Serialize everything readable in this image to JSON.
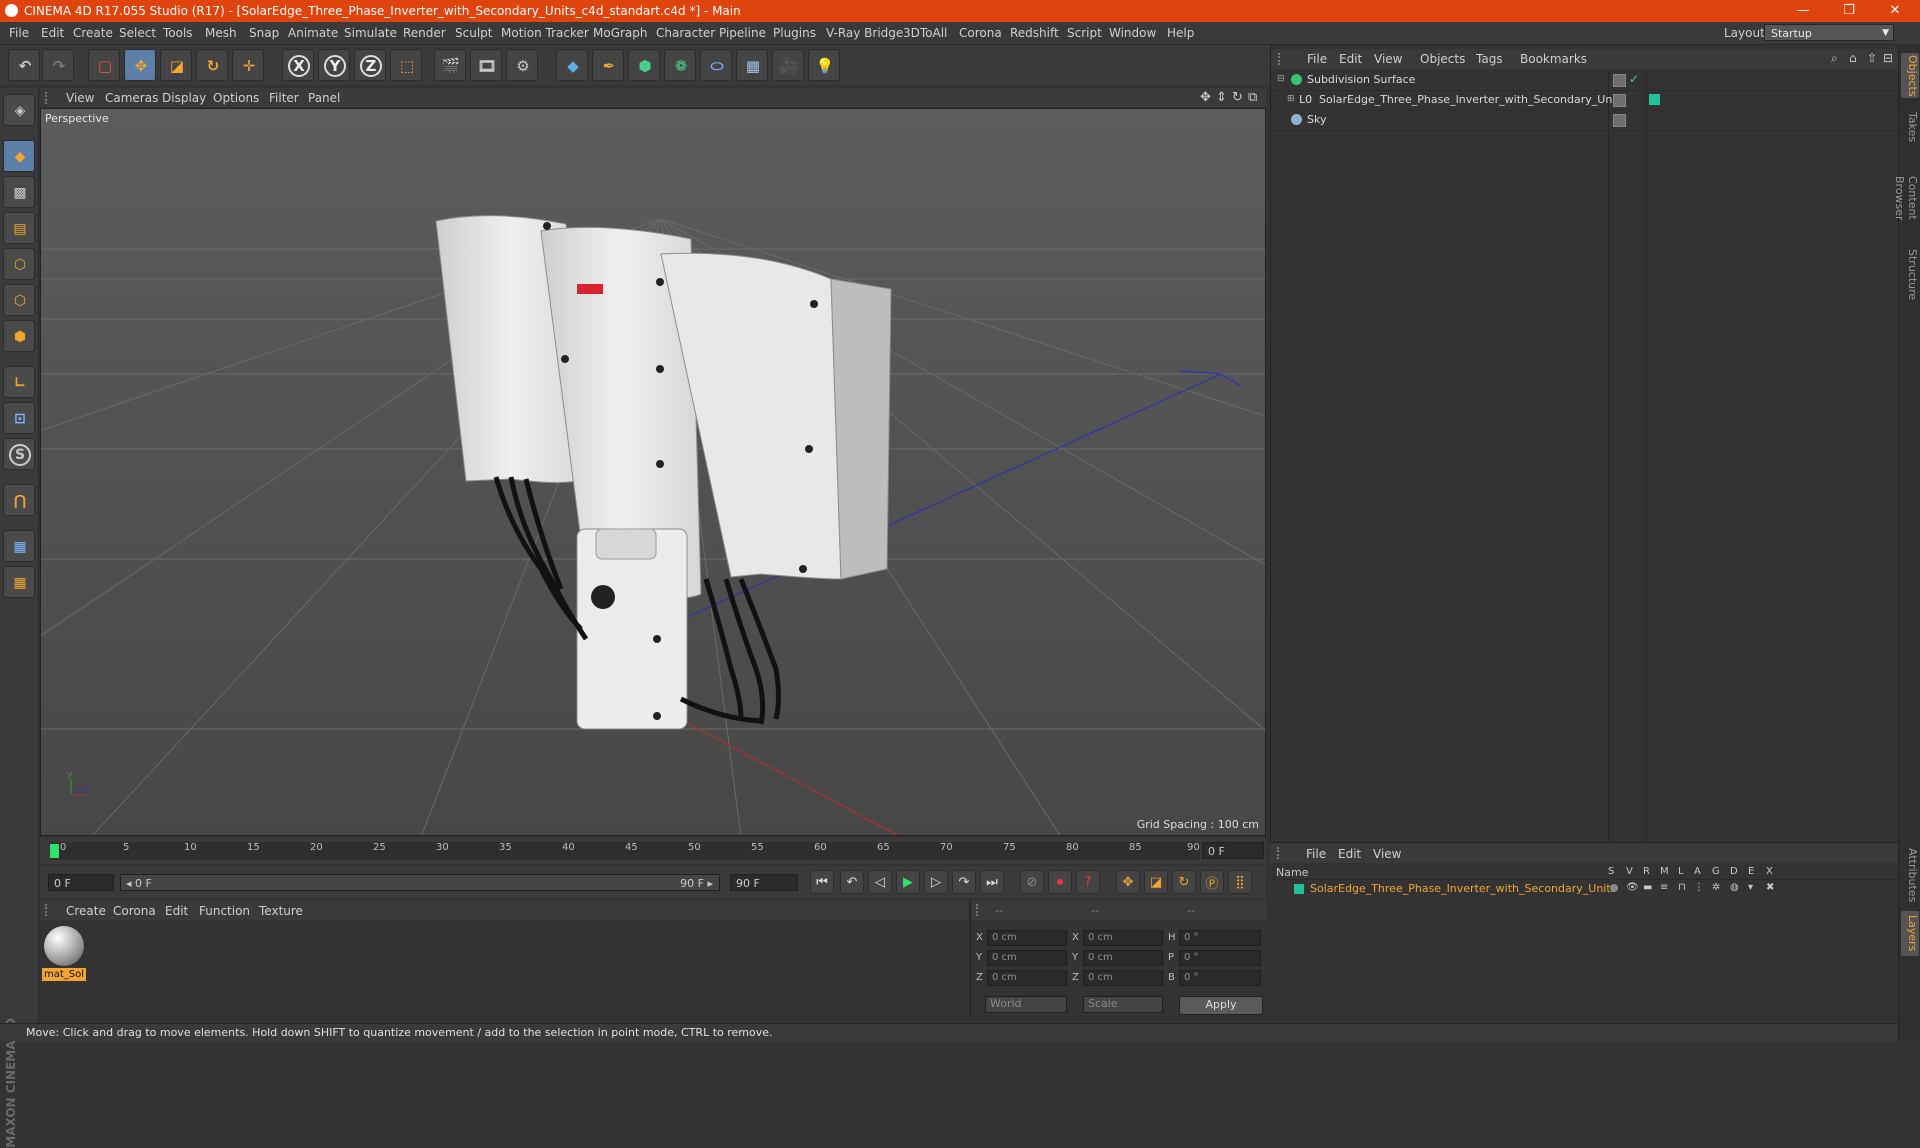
{
  "window": {
    "title": "CINEMA 4D R17.055 Studio (R17) - [SolarEdge_Three_Phase_Inverter_with_Secondary_Units_c4d_standart.c4d *] - Main",
    "minimize": "—",
    "restore": "❐",
    "close": "✕"
  },
  "menu": [
    "File",
    "Edit",
    "Create",
    "Select",
    "Tools",
    "Mesh",
    "Snap",
    "Animate",
    "Simulate",
    "Render",
    "Sculpt",
    "Motion Tracker",
    "MoGraph",
    "Character",
    "Pipeline",
    "Plugins",
    "V-Ray Bridge",
    "3DToAll",
    "Corona",
    "Redshift",
    "Script",
    "Window",
    "Help"
  ],
  "layout": {
    "label": "Layout:",
    "value": "Startup"
  },
  "toolbar": {
    "axis_x": "X",
    "axis_y": "Y",
    "axis_z": "Z"
  },
  "viewport": {
    "menu": [
      "View",
      "Cameras",
      "Display",
      "Options",
      "Filter",
      "Panel"
    ],
    "label": "Perspective",
    "grid_spacing": "Grid Spacing : 100 cm",
    "colors": {
      "background": "#4d4d4d",
      "x_axis": "#b03030",
      "y_axis": "#2fa02f",
      "z_axis": "#3030b0"
    }
  },
  "objects": {
    "menu": [
      "File",
      "Edit",
      "View",
      "Objects",
      "Tags",
      "Bookmarks"
    ],
    "items": [
      {
        "name": "Subdivision Surface"
      },
      {
        "name": "SolarEdge_Three_Phase_Inverter_with_Secondary_Units"
      },
      {
        "name": "Sky"
      }
    ]
  },
  "right_tabs": [
    "Objects",
    "Takes",
    "Content Browser",
    "Structure",
    "Attributes",
    "Layers"
  ],
  "timeline": {
    "ticks": [
      "0",
      "5",
      "10",
      "15",
      "20",
      "25",
      "30",
      "35",
      "40",
      "45",
      "50",
      "55",
      "60",
      "65",
      "70",
      "75",
      "80",
      "85",
      "90"
    ],
    "current_frame": "0 F",
    "start_frame": "0 F",
    "range_start": "◂ 0 F",
    "range_end": "90 F ▸",
    "end_frame": "90 F"
  },
  "materials": {
    "menu": [
      "Create",
      "Corona",
      "Edit",
      "Function",
      "Texture"
    ],
    "items": [
      {
        "name": "mat_Sol"
      }
    ]
  },
  "coordinates": {
    "header": [
      "--",
      "--",
      "--"
    ],
    "rows": [
      {
        "a": "X",
        "av": "0 cm",
        "b": "X",
        "bv": "0 cm",
        "c": "H",
        "cv": "0 °"
      },
      {
        "a": "Y",
        "av": "0 cm",
        "b": "Y",
        "bv": "0 cm",
        "c": "P",
        "cv": "0 °"
      },
      {
        "a": "Z",
        "av": "0 cm",
        "b": "Z",
        "bv": "0 cm",
        "c": "B",
        "cv": "0 °"
      }
    ],
    "world": "World",
    "scale": "Scale",
    "apply": "Apply"
  },
  "layers": {
    "menu": [
      "File",
      "Edit",
      "View"
    ],
    "columns": [
      "Name",
      "S",
      "V",
      "R",
      "M",
      "L",
      "A",
      "G",
      "D",
      "E",
      "X"
    ],
    "items": [
      {
        "name": "SolarEdge_Three_Phase_Inverter_with_Secondary_Units"
      }
    ]
  },
  "status": "Move: Click and drag to move elements. Hold down SHIFT to quantize movement / add to the selection in point mode, CTRL to remove.",
  "brand": "MAXON CINEMA 4D"
}
